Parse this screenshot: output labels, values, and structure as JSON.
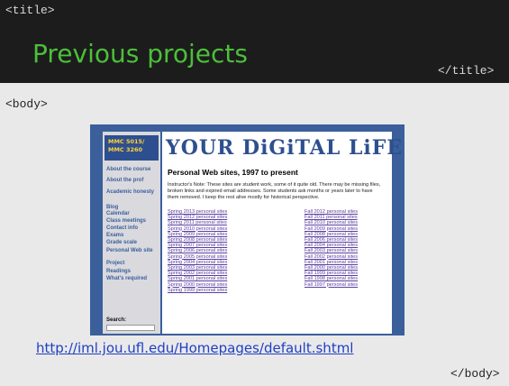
{
  "slide": {
    "open_title_tag": "<title>",
    "title": "Previous projects",
    "close_title_tag": "</title>",
    "open_body_tag": "<body>",
    "close_body_tag": "</body>",
    "url": "http://iml.jou.ufl.edu/Homepages/default.shtml"
  },
  "site": {
    "logo": "MMC 5015/\nMMC 3260",
    "banner": "YOUR DiGiTAL LiFE",
    "nav": [
      "About the course",
      "About the prof",
      "Academic honesty",
      "Blog",
      "Calendar",
      "Class meetings",
      "Contact info",
      "Exams",
      "Grade scale",
      "Personal Web site",
      "Project",
      "Readings",
      "What's required"
    ],
    "search_label": "Search:",
    "heading": "Personal Web sites, 1997 to present",
    "note": "Instructor's Note: These sites are student work, some of it quite old. There may be missing files, broken links and expired email addresses. Some students ask months or years later to have them removed. I keep the rest alive mostly for historical perspective.",
    "spring_links": [
      "Spring 2013 personal sites",
      "Spring 2012 personal sites",
      "Spring 2011 personal sites",
      "Spring 2010 personal sites",
      "Spring 2009 personal sites",
      "Spring 2008 personal sites",
      "Spring 2007 personal sites",
      "Spring 2006 personal sites",
      "Spring 2005 personal sites",
      "Spring 2004 personal sites",
      "Spring 2003 personal sites",
      "Spring 2002 personal sites",
      "Spring 2001 personal sites",
      "Spring 2000 personal sites",
      "Spring 1999 personal sites"
    ],
    "fall_links": [
      "Fall 2012 personal sites",
      "Fall 2011 personal sites",
      "Fall 2010 personal sites",
      "Fall 2009 personal sites",
      "Fall 2008 personal sites",
      "Fall 2006 personal sites",
      "Fall 2004 personal sites",
      "Fall 2003 personal sites",
      "Fall 2002 personal sites",
      "Fall 2001 personal sites",
      "Fall 2000 personal sites",
      "Fall 1999 personal sites",
      "Fall 1998 personal sites",
      "Fall 1997 personal sites"
    ]
  },
  "colors": {
    "title_bar": "#1c1c1c",
    "title_text": "#4cbf3a",
    "slide_background": "#e9e9e9",
    "site_frame": "#3b5f9a",
    "link": "#1f3fc4"
  }
}
